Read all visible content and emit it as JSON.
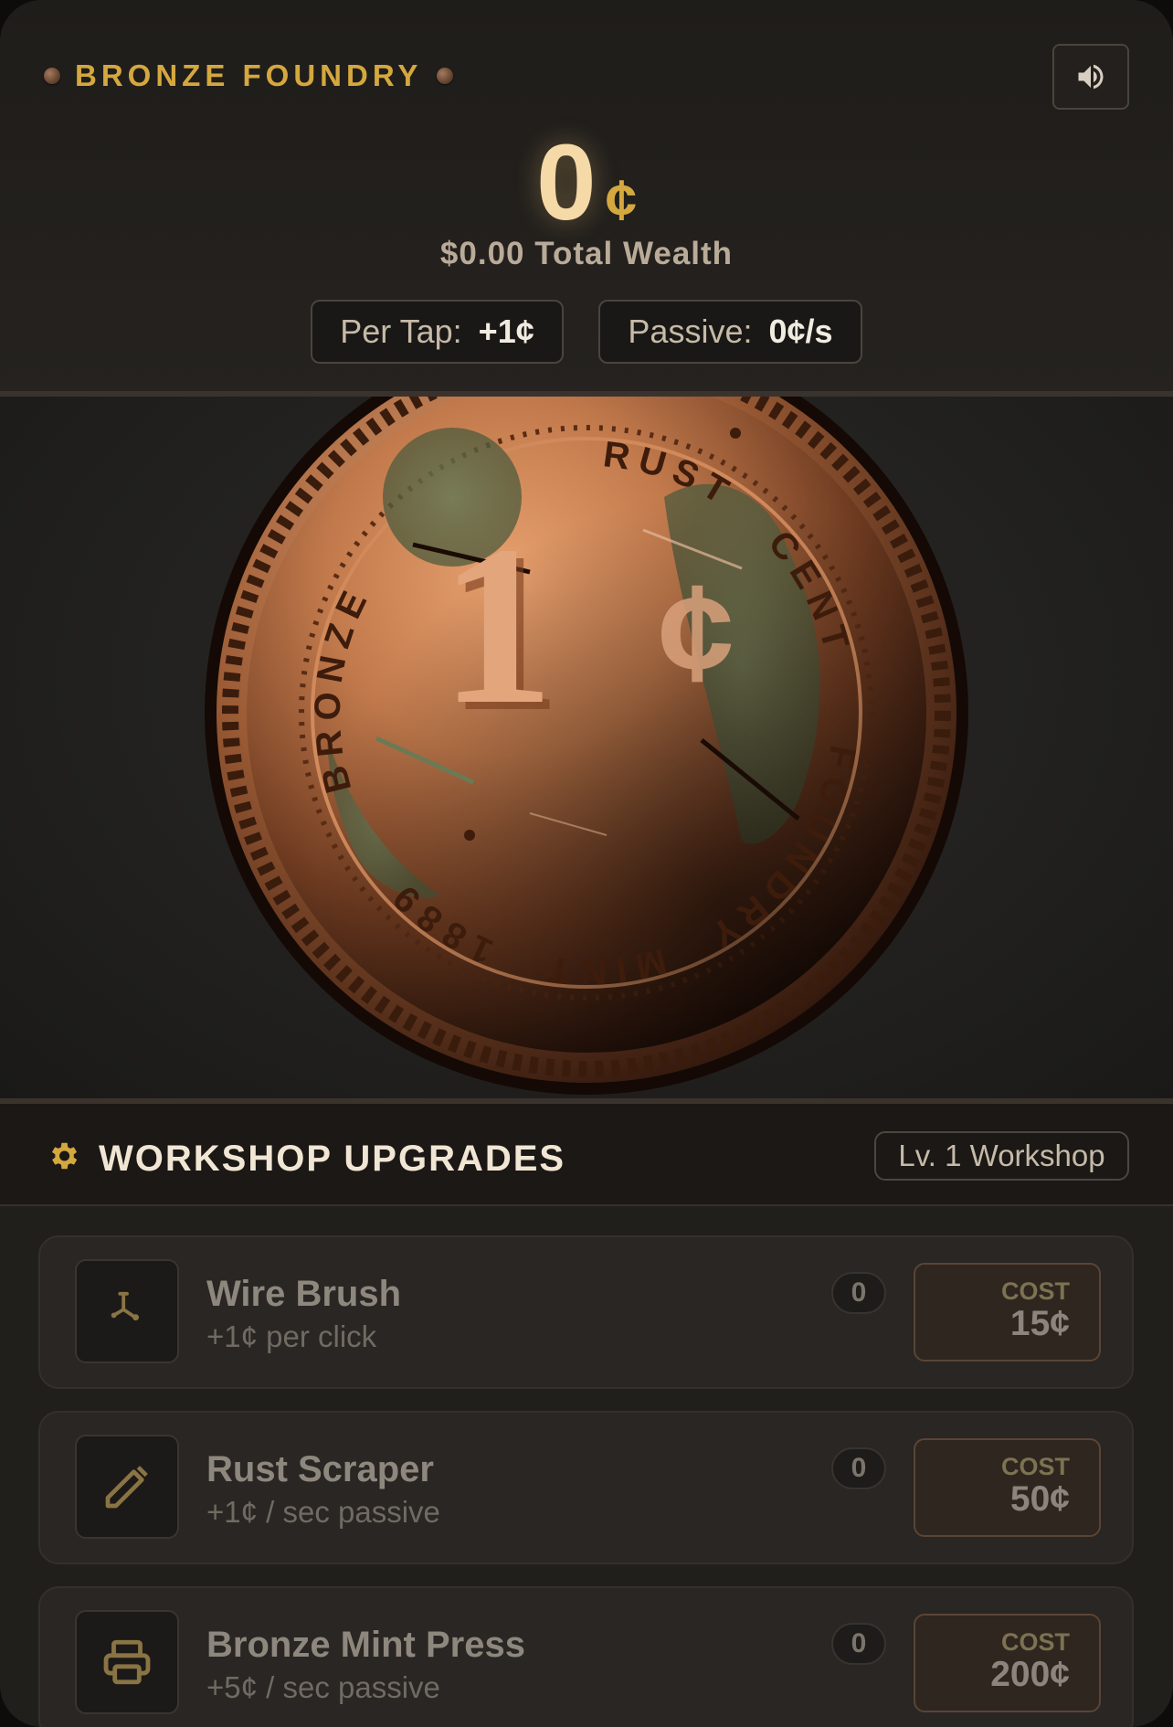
{
  "header": {
    "brand": "BRONZE FOUNDRY",
    "sound_icon": "speaker-icon",
    "balance_value": "0",
    "balance_unit": "¢",
    "wealth": "$0.00 Total Wealth",
    "per_tap_label": "Per Tap:",
    "per_tap_value": "+1¢",
    "passive_label": "Passive:",
    "passive_value": "0¢/s"
  },
  "coin": {
    "face_value": "1",
    "face_unit": "¢",
    "ring_words": [
      "BRONZE",
      "RUST",
      "CENT",
      "FOUNDRY",
      "MINT",
      "1889"
    ]
  },
  "upgrades": {
    "title": "WORKSHOP UPGRADES",
    "title_icon": "gear-icon",
    "level_badge": "Lv. 1 Workshop",
    "cost_label": "COST",
    "items": [
      {
        "name": "Wire Brush",
        "desc": "+1¢ per click",
        "owned": "0",
        "cost": "15¢",
        "icon": "wire-brush-icon"
      },
      {
        "name": "Rust Scraper",
        "desc": "+1¢ / sec passive",
        "owned": "0",
        "cost": "50¢",
        "icon": "pencil-icon"
      },
      {
        "name": "Bronze Mint Press",
        "desc": "+5¢ / sec passive",
        "owned": "0",
        "cost": "200¢",
        "icon": "printer-icon"
      }
    ]
  },
  "colors": {
    "accent_gold": "#d4a83f",
    "bronze": "#c7825a",
    "patina": "#5d6b4a",
    "background": "#211f1c"
  }
}
